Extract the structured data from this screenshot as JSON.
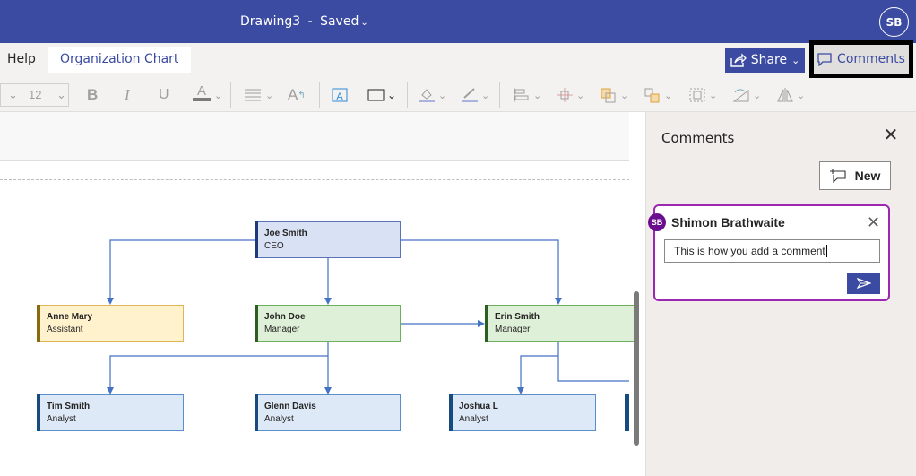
{
  "titlebar": {
    "doc_name": "Drawing3",
    "separator": "-",
    "status": "Saved",
    "user_initials": "SB"
  },
  "ribbon": {
    "tabs": [
      {
        "label": "Help"
      },
      {
        "label": "Organization Chart",
        "active": true
      }
    ],
    "share_label": "Share",
    "comments_label": "Comments",
    "font_size": "12",
    "tools": [
      "bold-icon",
      "italic-icon",
      "underline-icon",
      "font-color-icon",
      "align-icon",
      "text-size-icon",
      "text-box-icon",
      "shape-icon",
      "fill-icon",
      "line-color-icon",
      "align-shapes-icon",
      "position-icon",
      "bring-forward-icon",
      "send-backward-icon",
      "group-icon",
      "rotate-icon",
      "flip-icon"
    ]
  },
  "colors": {
    "brand": "#3b4ba2",
    "comment_border": "#9c27b0",
    "avatar": "#6a0e8e"
  },
  "org_chart": {
    "nodes": [
      {
        "id": "joe",
        "name": "Joe Smith",
        "title": "CEO",
        "style": "ceo"
      },
      {
        "id": "anne",
        "name": "Anne Mary",
        "title": "Assistant",
        "style": "assistant"
      },
      {
        "id": "john",
        "name": "John Doe",
        "title": "Manager",
        "style": "manager"
      },
      {
        "id": "erin",
        "name": "Erin Smith",
        "title": "Manager",
        "style": "manager"
      },
      {
        "id": "tim",
        "name": "Tim Smith",
        "title": "Analyst",
        "style": "analyst"
      },
      {
        "id": "glenn",
        "name": "Glenn Davis",
        "title": "Analyst",
        "style": "analyst"
      },
      {
        "id": "joshua",
        "name": "Joshua L",
        "title": "Analyst",
        "style": "analyst"
      }
    ]
  },
  "comments_panel": {
    "title": "Comments",
    "new_label": "New",
    "draft": {
      "author_initials": "SB",
      "author": "Shimon Brathwaite",
      "text": "This is how you add a comment"
    }
  }
}
